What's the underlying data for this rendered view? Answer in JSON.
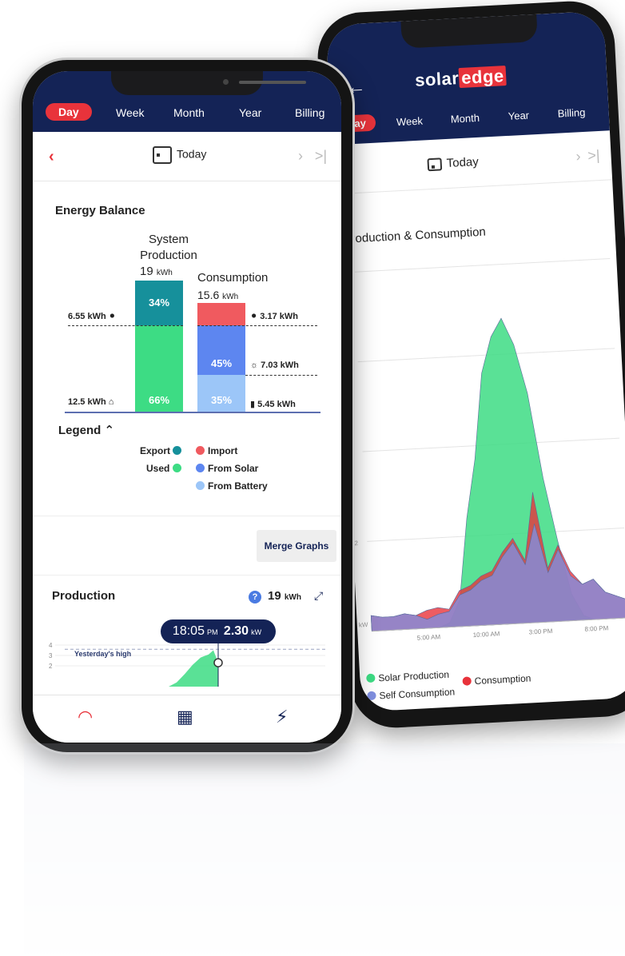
{
  "right_phone": {
    "logo_prefix": "solar",
    "logo_suffix": "edge",
    "tabs": [
      "Day",
      "Week",
      "Month",
      "Year",
      "Billing"
    ],
    "active_tab": "Day",
    "date_label": "Today",
    "chart_title": "Production & Consumption",
    "legend": {
      "solar_production": "Solar Production",
      "consumption": "Consumption",
      "self_consumption": "Self Consumption"
    },
    "colors": {
      "solar": "#3ddc84",
      "consumption": "#e8333b",
      "self": "#7f8fe0"
    }
  },
  "left_phone": {
    "tabs": [
      "Day",
      "Week",
      "Month",
      "Year",
      "Billing"
    ],
    "active_tab": "Day",
    "date_label": "Today",
    "energy_balance": {
      "title": "Energy Balance",
      "production_label_1": "System",
      "production_label_2": "Production",
      "production_value": "19",
      "production_unit": "kWh",
      "consumption_label": "Consumption",
      "consumption_value": "15.6",
      "consumption_unit": "kWh",
      "export_kwh": "6.55",
      "used_kwh": "12.5",
      "import_kwh": "3.17",
      "solar_kwh": "7.03",
      "battery_kwh": "5.45",
      "kwh_unit": "kWh",
      "export_pct": "34%",
      "used_pct": "66%",
      "solar_pct": "45%",
      "battery_pct": "35%"
    },
    "legend": {
      "title": "Legend",
      "export": "Export",
      "used": "Used",
      "import": "Import",
      "from_solar": "From Solar",
      "from_battery": "From Battery"
    },
    "merge_button": "Merge Graphs",
    "production": {
      "title": "Production",
      "total": "19",
      "unit": "kWh",
      "tooltip_time": "18:05",
      "tooltip_ampm": "PM",
      "tooltip_value": "2.30",
      "tooltip_unit": "kW",
      "yesterday_label": "Yesterday's high"
    },
    "colors": {
      "export": "#16909b",
      "used": "#3ddc84",
      "import": "#f05a5f",
      "from_solar": "#5d86f0",
      "from_battery": "#9cc6f8",
      "navy": "#142356",
      "red": "#e8333b"
    }
  },
  "chart_data": {
    "type": "area",
    "title": "Production & Consumption",
    "ylabel": "kW",
    "ylim": [
      0,
      8
    ],
    "yticks": [
      "2",
      "4",
      "6",
      "8"
    ],
    "x_ticks": [
      "5:00 AM",
      "10:00 AM",
      "3:00 PM",
      "8:00 PM"
    ],
    "x": [
      "0:00",
      "1:00",
      "2:00",
      "3:00",
      "4:00",
      "5:00",
      "6:00",
      "7:00",
      "8:00",
      "9:00",
      "10:00",
      "11:00",
      "12:00",
      "13:00",
      "14:00",
      "15:00",
      "16:00",
      "17:00",
      "18:00",
      "19:00",
      "20:00",
      "21:00",
      "22:00",
      "23:00"
    ],
    "series": [
      {
        "name": "Solar Production",
        "values": [
          0,
          0,
          0,
          0,
          0,
          0,
          0,
          0.1,
          0.6,
          2.4,
          3.7,
          5.6,
          6.4,
          6.8,
          6.2,
          5.1,
          3.2,
          1.8,
          0.6,
          0.1,
          0,
          0,
          0,
          0
        ]
      },
      {
        "name": "Consumption",
        "values": [
          0.35,
          0.3,
          0.3,
          0.35,
          0.3,
          0.4,
          0.45,
          0.4,
          0.8,
          0.9,
          1.1,
          1.2,
          1.6,
          1.9,
          1.4,
          2.9,
          1.2,
          1.7,
          1.1,
          0.8,
          0.9,
          0.6,
          0.5,
          0.4
        ]
      },
      {
        "name": "Self Consumption",
        "values": [
          0.35,
          0.3,
          0.3,
          0.35,
          0.3,
          0.2,
          0.3,
          0.35,
          0.7,
          0.8,
          1.0,
          1.1,
          1.5,
          1.8,
          1.3,
          2.2,
          1.1,
          1.6,
          1.0,
          0.8,
          0.9,
          0.6,
          0.5,
          0.4
        ]
      }
    ]
  },
  "production_mini_chart": {
    "yticks": [
      "4",
      "3",
      "2"
    ],
    "yesterday_high": 3.6,
    "values": [
      0,
      0.4,
      1.2,
      2.1,
      2.8,
      3.1,
      3.5,
      2.3
    ]
  },
  "bottom_nav": {
    "dashboard": "gauge-icon",
    "layout": "grid-icon",
    "charging": "ev-charger-icon"
  }
}
